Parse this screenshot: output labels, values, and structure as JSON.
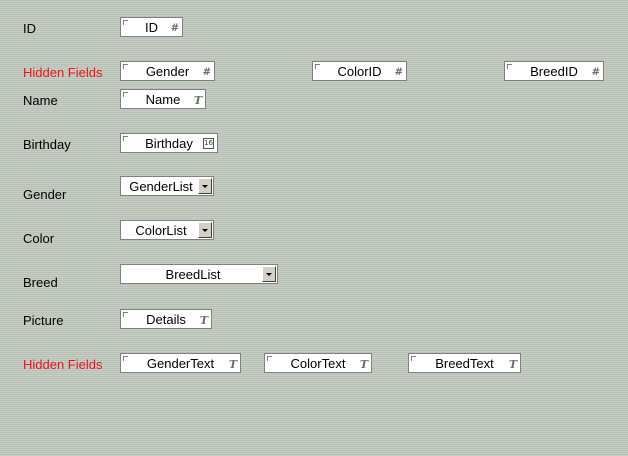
{
  "labels": {
    "id": "ID",
    "hidden_fields_1": "Hidden Fields",
    "name": "Name",
    "birthday": "Birthday",
    "gender": "Gender",
    "color": "Color",
    "breed": "Breed",
    "picture": "Picture",
    "hidden_fields_2": "Hidden Fields"
  },
  "fields": {
    "id": "ID",
    "gender": "Gender",
    "color_id": "ColorID",
    "breed_id": "BreedID",
    "name": "Name",
    "birthday": "Birthday",
    "gender_list": "GenderList",
    "color_list": "ColorList",
    "breed_list": "BreedList",
    "details": "Details",
    "gender_text": "GenderText",
    "color_text": "ColorText",
    "breed_text": "BreedText"
  },
  "badges": {
    "number": "#",
    "text": "T",
    "date": "16"
  },
  "colors": {
    "hidden_label": "#e8141a",
    "background": "#bfc7bd"
  }
}
